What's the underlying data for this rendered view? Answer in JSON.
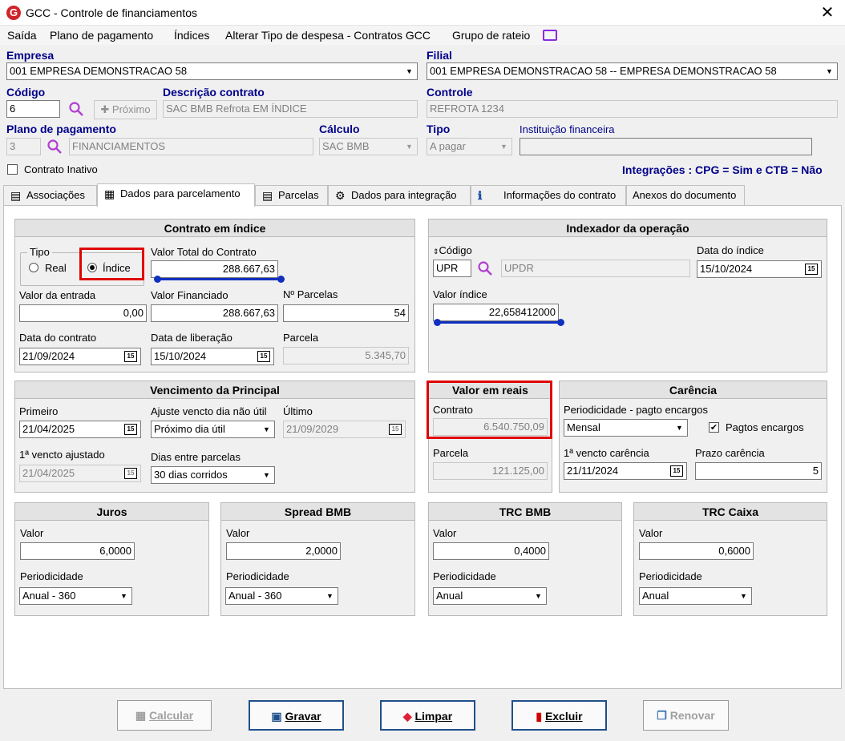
{
  "window": {
    "title": "GCC - Controle de financiamentos",
    "close": "✕"
  },
  "menu": [
    "Saída",
    "Plano de pagamento",
    "Índices",
    "Alterar Tipo de despesa - Contratos GCC",
    "Grupo de rateio"
  ],
  "header": {
    "empresa_label": "Empresa",
    "empresa_value": "001 EMPRESA DEMONSTRACAO 58",
    "filial_label": "Filial",
    "filial_value": "001 EMPRESA DEMONSTRACAO 58 -- EMPRESA DEMONSTRACAO 58",
    "codigo_label": "Código",
    "codigo_value": "6",
    "proximo_label": "Próximo",
    "descricao_label": "Descrição contrato",
    "descricao_value": "SAC BMB Refrota EM ÍNDICE",
    "controle_label": "Controle",
    "controle_value": "REFROTA 1234",
    "plano_label": "Plano de pagamento",
    "plano_code": "3",
    "plano_desc": "FINANCIAMENTOS",
    "calculo_label": "Cálculo",
    "calculo_value": "SAC BMB",
    "tipo_label": "Tipo",
    "tipo_value": "A pagar",
    "instituicao_label": "Instituição financeira",
    "instituicao_value": "",
    "contrato_inativo_label": "Contrato Inativo",
    "integracoes": "Integrações : CPG = Sim e CTB = Não"
  },
  "tabs": [
    {
      "label": "Associações",
      "icon": "▤"
    },
    {
      "label": "Dados para parcelamento",
      "icon": "▦"
    },
    {
      "label": "Parcelas",
      "icon": "▤"
    },
    {
      "label": "Dados para integração",
      "icon": "⚙"
    },
    {
      "label": "Informações do contrato",
      "icon": "ℹ"
    },
    {
      "label": "Anexos do documento",
      "icon": ""
    }
  ],
  "contrato_indice": {
    "title": "Contrato em índice",
    "tipo_label": "Tipo",
    "real_label": "Real",
    "indice_label": "Índice",
    "valor_total_label": "Valor Total do Contrato",
    "valor_total": "288.667,63",
    "valor_entrada_label": "Valor da entrada",
    "valor_entrada": "0,00",
    "valor_financiado_label": "Valor Financiado",
    "valor_financiado": "288.667,63",
    "parcelas_label": "Nº Parcelas",
    "parcelas": "54",
    "data_contrato_label": "Data do contrato",
    "data_contrato": "21/09/2024",
    "data_liberacao_label": "Data de liberação",
    "data_liberacao": "15/10/2024",
    "parcela_label": "Parcela",
    "parcela": "5.345,70"
  },
  "indexador": {
    "title": "Indexador da operação",
    "codigo_label": "Código",
    "codigo": "UPR",
    "codigo_desc": "UPDR",
    "data_indice_label": "Data do índice",
    "data_indice": "15/10/2024",
    "valor_indice_label": "Valor índice",
    "valor_indice": "22,658412000"
  },
  "vencimento": {
    "title": "Vencimento da Principal",
    "primeiro_label": "Primeiro",
    "primeiro": "21/04/2025",
    "ajuste_label": "Ajuste vencto dia não útil",
    "ajuste": "Próximo dia útil",
    "ultimo_label": "Último",
    "ultimo": "21/09/2029",
    "ajustado_label": "1ª vencto ajustado",
    "ajustado": "21/04/2025",
    "dias_label": "Dias entre parcelas",
    "dias": "30 dias corridos"
  },
  "valor_reais": {
    "title": "Valor em reais",
    "contrato_label": "Contrato",
    "contrato": "6.540.750,09",
    "parcela_label": "Parcela",
    "parcela": "121.125,00"
  },
  "carencia": {
    "title": "Carência",
    "periodicidade_label": "Periodicidade - pagto encargos",
    "periodicidade": "Mensal",
    "pagtos_label": "Pagtos encargos",
    "vencto_label": "1ª vencto carência",
    "vencto": "21/11/2024",
    "prazo_label": "Prazo carência",
    "prazo": "5"
  },
  "juros": {
    "title": "Juros",
    "valor_label": "Valor",
    "valor": "6,0000",
    "period_label": "Periodicidade",
    "period": "Anual - 360"
  },
  "spread": {
    "title": "Spread BMB",
    "valor_label": "Valor",
    "valor": "2,0000",
    "period_label": "Periodicidade",
    "period": "Anual - 360"
  },
  "trc_bmb": {
    "title": "TRC BMB",
    "valor_label": "Valor",
    "valor": "0,4000",
    "period_label": "Periodicidade",
    "period": "Anual"
  },
  "trc_caixa": {
    "title": "TRC Caixa",
    "valor_label": "Valor",
    "valor": "0,6000",
    "period_label": "Periodicidade",
    "period": "Anual"
  },
  "buttons": {
    "calcular": "Calcular",
    "gravar": "Gravar",
    "limpar": "Limpar",
    "excluir": "Excluir",
    "renovar": "Renovar"
  },
  "cal_icon": "15",
  "colors": {
    "label_blue": "#00008b",
    "highlight_red": "#e00000",
    "underline_blue": "#1030c0",
    "brand_red": "#d0232a"
  }
}
